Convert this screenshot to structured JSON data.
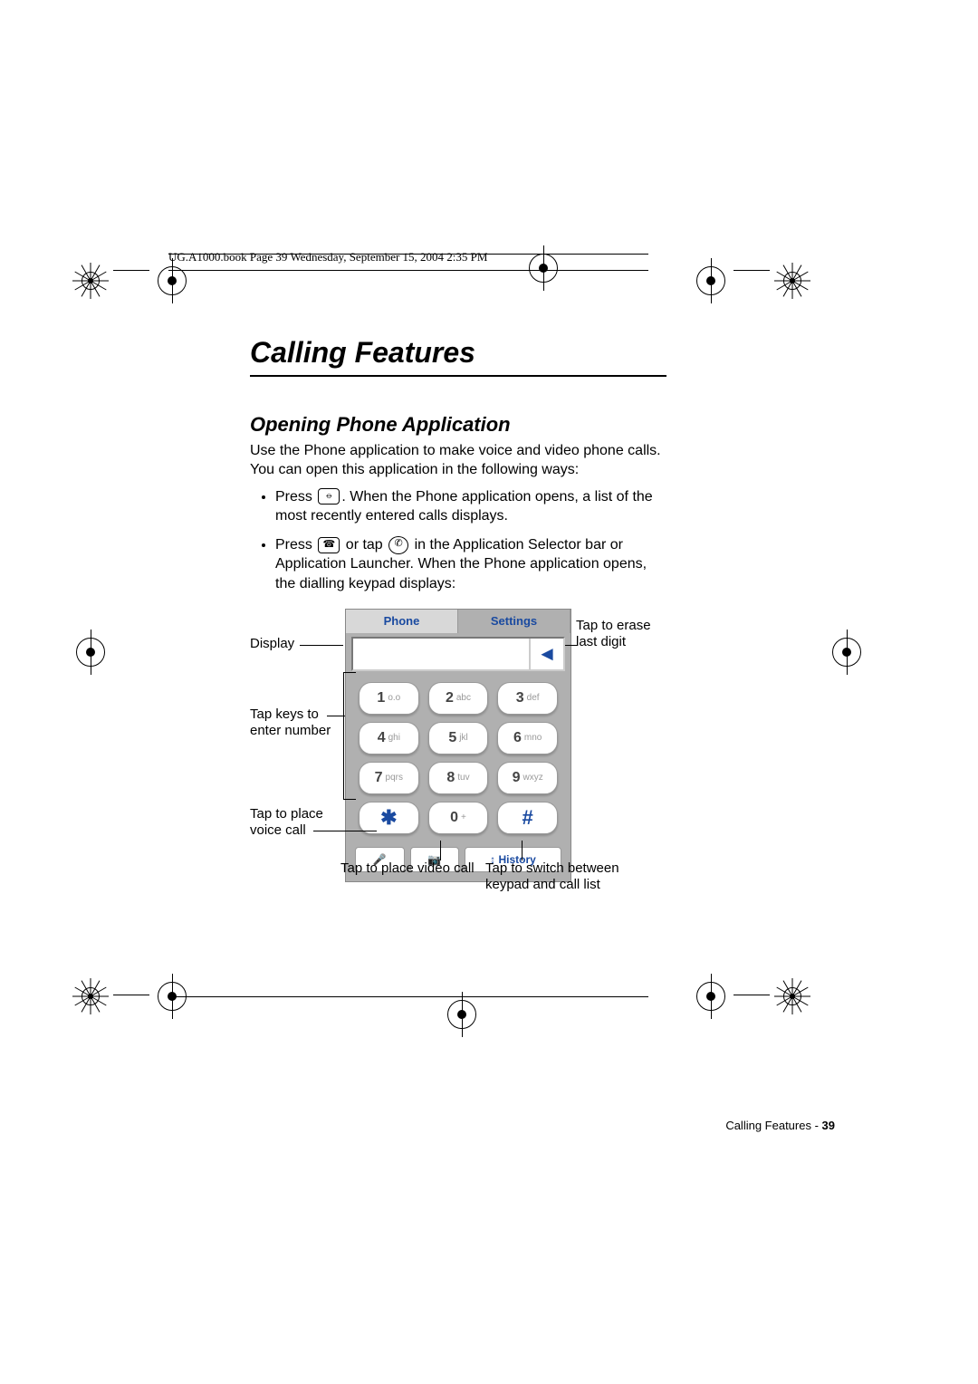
{
  "header_line": "UG.A1000.book  Page 39  Wednesday, September 15, 2004  2:35 PM",
  "chapter_title": "Calling Features",
  "section_title": "Opening Phone Application",
  "intro_paragraph": "Use the Phone application to make voice and video phone calls. You can open this application in the following ways:",
  "bullet1_pre": "Press ",
  "bullet1_post": ". When the Phone application opens, a list of the most recently entered calls displays.",
  "bullet2_pre": "Press ",
  "bullet2_mid": " or tap ",
  "bullet2_post": " in the Application Selector bar or Application Launcher. When the Phone application opens, the dialling keypad displays:",
  "phone": {
    "tab1": "Phone",
    "tab2": "Settings",
    "erase_symbol": "◄",
    "keys": [
      {
        "num": "1",
        "sub": "o.o"
      },
      {
        "num": "2",
        "sub": "abc"
      },
      {
        "num": "3",
        "sub": "def"
      },
      {
        "num": "4",
        "sub": "ghi"
      },
      {
        "num": "5",
        "sub": "jkl"
      },
      {
        "num": "6",
        "sub": "mno"
      },
      {
        "num": "7",
        "sub": "pqrs"
      },
      {
        "num": "8",
        "sub": "tuv"
      },
      {
        "num": "9",
        "sub": "wxyz"
      },
      {
        "num": "✱",
        "sub": ""
      },
      {
        "num": "0",
        "sub": "+"
      },
      {
        "num": "#",
        "sub": ""
      }
    ],
    "bottom": {
      "voice": "🎤",
      "video": "📷",
      "history": "↕ History"
    }
  },
  "callouts": {
    "display": "Display",
    "erase": "Tap to erase last digit",
    "keys": "Tap keys to enter number",
    "voice": "Tap to place voice call",
    "video": "Tap to place video call",
    "history": "Tap to switch between keypad and call list"
  },
  "footer": {
    "label": "Calling Features - ",
    "page": "39"
  }
}
